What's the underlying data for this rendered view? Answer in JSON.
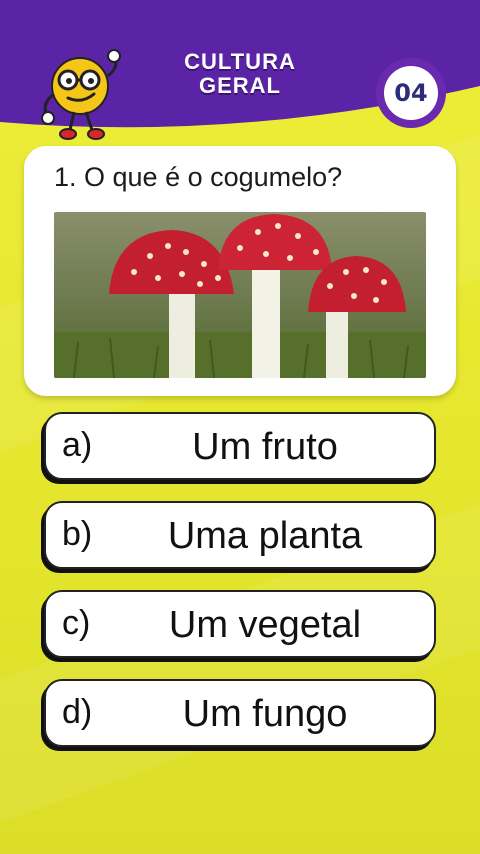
{
  "header": {
    "title_line1": "CULTURA",
    "title_line2": "GERAL",
    "question_counter": "04",
    "colors": {
      "band": "#5b24a6",
      "counter_ring": "#6a2ab0"
    }
  },
  "question": {
    "text": "1. O que é o cogumelo?",
    "image": "amanita-mushrooms-photo"
  },
  "answers": [
    {
      "letter": "a)",
      "text": "Um fruto"
    },
    {
      "letter": "b)",
      "text": "Uma planta"
    },
    {
      "letter": "c)",
      "text": "Um vegetal"
    },
    {
      "letter": "d)",
      "text": "Um fungo"
    }
  ],
  "background": {
    "color": "#e7e832"
  }
}
